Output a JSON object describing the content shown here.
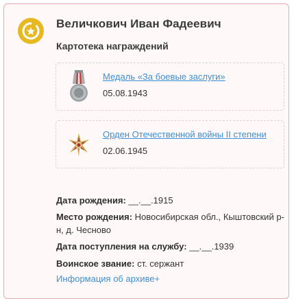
{
  "person": {
    "name": "Величкович Иван Фадеевич",
    "subtitle": "Картотека награждений"
  },
  "awards": [
    {
      "title": "Медаль «За боевые заслуги»",
      "date": "05.08.1943",
      "icon": "medal-icon"
    },
    {
      "title": "Орден Отечественной войны II степени",
      "date": "02.06.1945",
      "icon": "order-icon"
    }
  ],
  "details": {
    "birth_date_label": "Дата рождения:",
    "birth_date_value": "__.__.1915",
    "birth_place_label": "Место рождения:",
    "birth_place_value": "Новосибирская обл., Кыштовский р-н, д. Чесново",
    "service_start_label": "Дата поступления на службу:",
    "service_start_value": "__.__.1939",
    "rank_label": "Воинское звание:",
    "rank_value": "ст. сержант"
  },
  "archive_link": "Информация об архиве+",
  "colors": {
    "accent": "#e6b822",
    "link": "#3a8fd6",
    "border": "#e8a9ad"
  }
}
